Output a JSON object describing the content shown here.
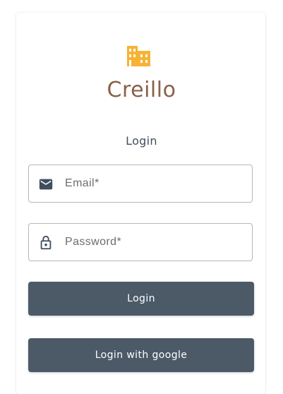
{
  "brand": {
    "name": "Creillo",
    "logo_icon": "building-icon",
    "logo_color": "#f6b334",
    "name_color": "#8a6048"
  },
  "form": {
    "title": "Login",
    "email": {
      "placeholder": "Email*",
      "value": "",
      "icon": "envelope-icon"
    },
    "password": {
      "placeholder": "Password*",
      "value": "",
      "icon": "lock-icon"
    },
    "login_button": "Login",
    "google_button": "Login with google",
    "button_color": "#4c5a68"
  }
}
